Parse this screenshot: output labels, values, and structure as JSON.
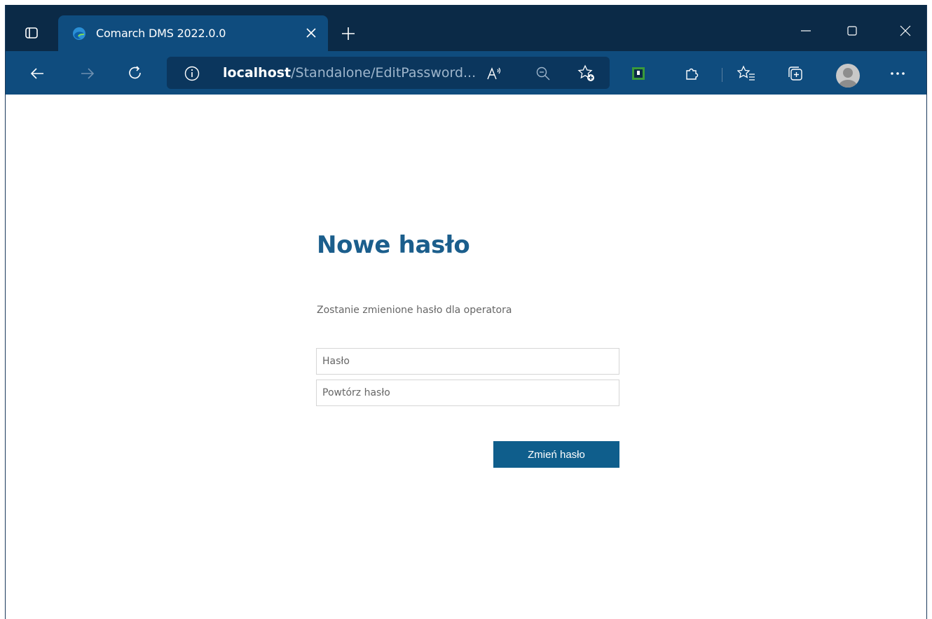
{
  "browser": {
    "tab_title": "Comarch DMS 2022.0.0",
    "url_host": "localhost",
    "url_path": "/Standalone/EditPassword...",
    "icons": [
      "tab-actions-icon",
      "edge-favicon",
      "close-icon",
      "plus-icon",
      "minimize-icon",
      "maximize-icon",
      "close-window-icon",
      "back-icon",
      "forward-icon",
      "refresh-icon",
      "info-icon",
      "read-aloud-icon",
      "zoom-out-icon",
      "add-favorite-icon",
      "extension-icon",
      "puzzle-icon",
      "favorites-icon",
      "collections-icon",
      "profile-icon",
      "more-icon"
    ]
  },
  "page": {
    "title": "Nowe hasło",
    "subtitle": "Zostanie zmienione hasło dla operatora",
    "password_placeholder": "Hasło",
    "repeat_placeholder": "Powtórz hasło",
    "submit_label": "Zmień hasło"
  },
  "colors": {
    "titlebar": "#0b2a47",
    "toolbar": "#0f4c7e",
    "accent": "#1b5e8c",
    "button": "#0f5e8c"
  }
}
